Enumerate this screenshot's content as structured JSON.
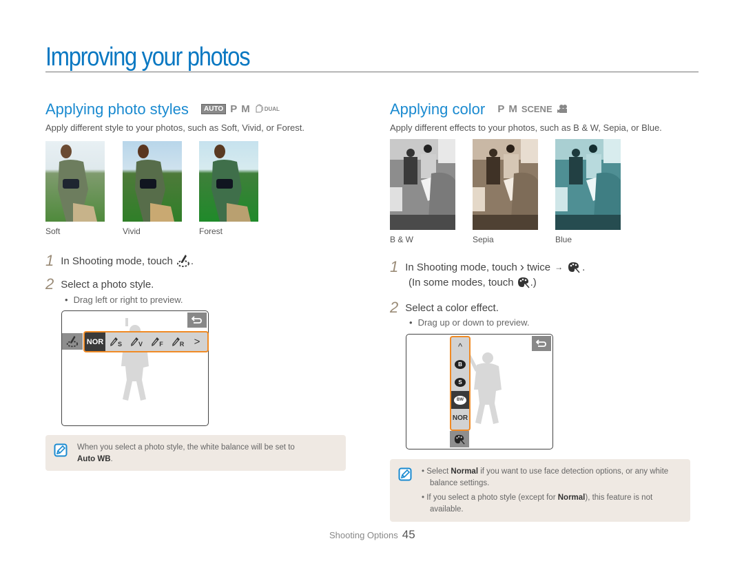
{
  "page": {
    "title": "Improving your photos",
    "footer_section": "Shooting Options",
    "footer_page": "45"
  },
  "left": {
    "title": "Applying photo styles",
    "modes": [
      "AUTO",
      "P",
      "M",
      "DUAL"
    ],
    "description": "Apply different style to your photos, such as Soft, Vivid, or Forest.",
    "photos": [
      {
        "caption": "Soft"
      },
      {
        "caption": "Vivid"
      },
      {
        "caption": "Forest"
      }
    ],
    "steps": [
      {
        "num": "1",
        "text": "In Shooting mode, touch",
        "icon": "photo-style-icon"
      },
      {
        "num": "2",
        "text": "Select a photo style.",
        "bullets": [
          "Drag left or right to preview."
        ]
      }
    ],
    "screen": {
      "items": [
        "NOR",
        "S",
        "V",
        "F",
        "R"
      ],
      "selected": "NOR",
      "next_symbol": ">",
      "back_icon": "back-arrow-icon"
    },
    "note": {
      "text": "When you select a photo style, the white balance will be set to",
      "bold": "Auto WB",
      "end": "."
    }
  },
  "right": {
    "title": "Applying color",
    "modes": [
      "P",
      "M",
      "SCENE",
      "movie"
    ],
    "description": "Apply different effects to your photos, such as B & W, Sepia, or Blue.",
    "photos": [
      {
        "caption": "B & W"
      },
      {
        "caption": "Sepia"
      },
      {
        "caption": "Blue"
      }
    ],
    "steps": [
      {
        "num": "1",
        "text_a": "In Shooting mode, touch",
        "text_b": "twice",
        "arrow": "→",
        "text_c": "(In some modes, touch",
        "text_d": ".)"
      },
      {
        "num": "2",
        "text": "Select a color effect.",
        "bullets": [
          "Drag up or down to preview."
        ]
      }
    ],
    "screen": {
      "items": [
        "^",
        "B",
        "S",
        "BW",
        "NOR"
      ],
      "selected": "BW"
    },
    "notes": [
      {
        "pre": "Select ",
        "bold": "Normal",
        "post": " if you want to use face detection options, or any white balance settings."
      },
      {
        "pre": "If you select a photo style (except for ",
        "bold": "Normal",
        "post": "), this feature is not available."
      }
    ]
  },
  "colors": {
    "title_blue": "#0a78c2",
    "highlight_orange": "#f08a24",
    "note_bg": "#efe9e3",
    "step_num": "#9a8b77"
  }
}
